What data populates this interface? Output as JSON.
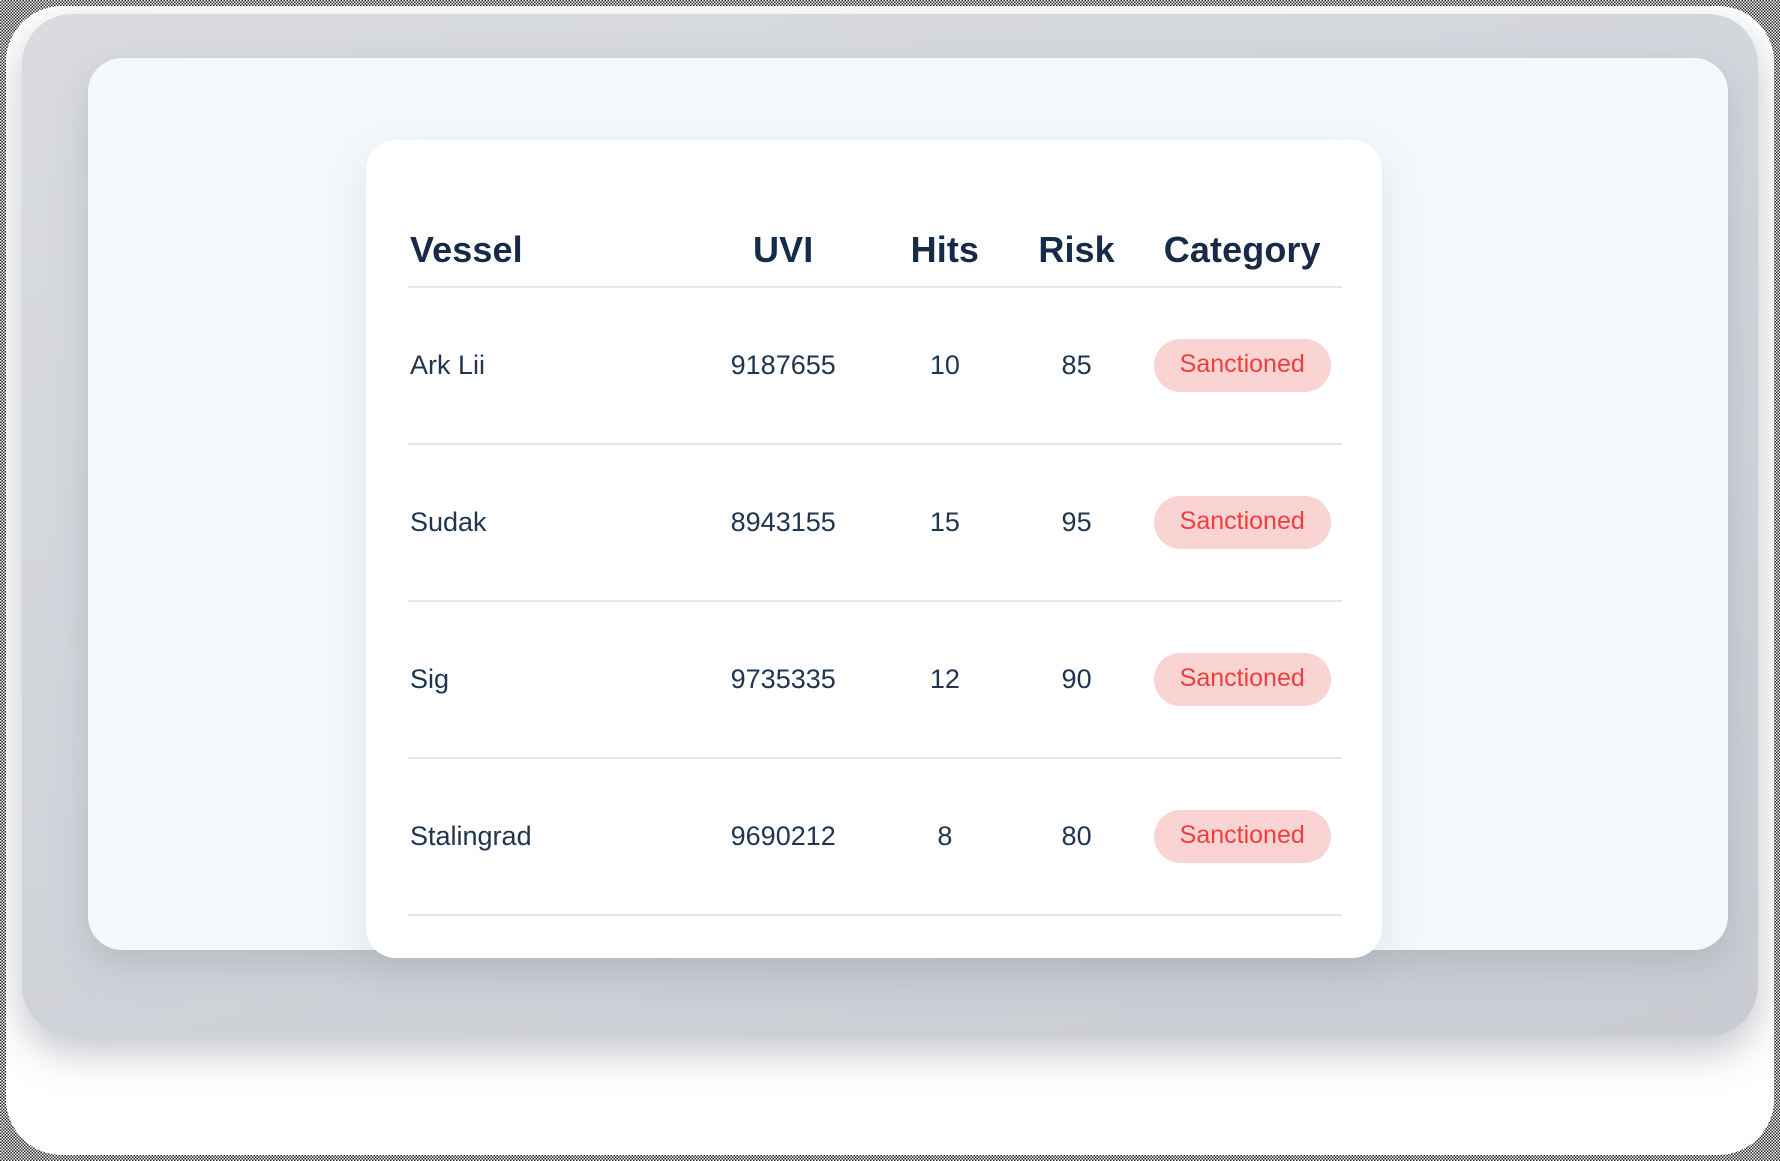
{
  "table": {
    "columns": [
      {
        "key": "vessel",
        "label": "Vessel"
      },
      {
        "key": "uvi",
        "label": "UVI"
      },
      {
        "key": "hits",
        "label": "Hits"
      },
      {
        "key": "risk",
        "label": "Risk"
      },
      {
        "key": "category",
        "label": "Category"
      }
    ],
    "rows": [
      {
        "vessel": "Ark Lii",
        "uvi": "9187655",
        "hits": "10",
        "risk": "85",
        "category": "Sanctioned"
      },
      {
        "vessel": "Sudak",
        "uvi": "8943155",
        "hits": "15",
        "risk": "95",
        "category": "Sanctioned"
      },
      {
        "vessel": "Sig",
        "uvi": "9735335",
        "hits": "12",
        "risk": "90",
        "category": "Sanctioned"
      },
      {
        "vessel": "Stalingrad",
        "uvi": "9690212",
        "hits": "8",
        "risk": "80",
        "category": "Sanctioned"
      }
    ]
  },
  "colors": {
    "header_text": "#152b47",
    "body_text": "#203550",
    "badge_bg": "#fad3d3",
    "badge_text": "#ef3e3e",
    "divider": "#e4e6e8",
    "panel_bg": "#f4f8fb",
    "card_bg": "#ffffff",
    "bezel": "#d2d5da"
  }
}
